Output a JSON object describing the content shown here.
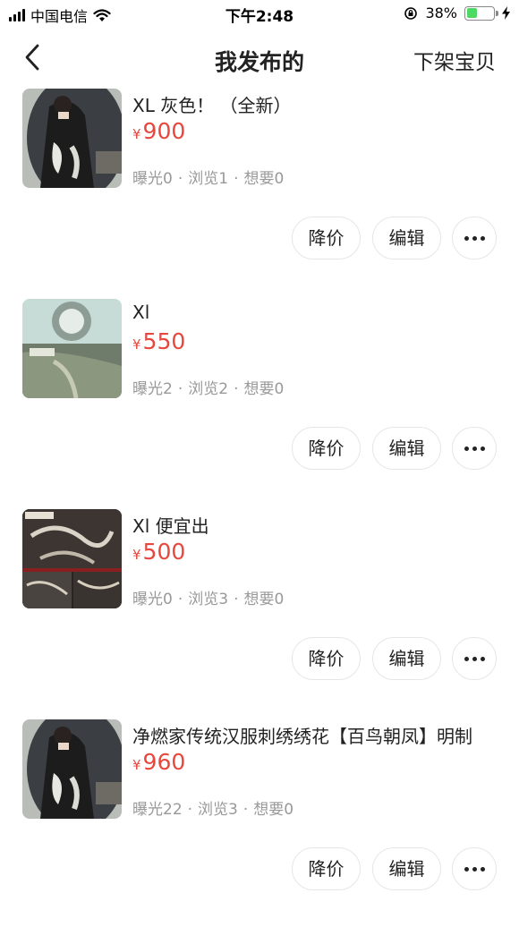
{
  "status_bar": {
    "carrier": "中国电信",
    "time": "下午2:48",
    "battery_percent": "38%",
    "battery_level": 0.38
  },
  "nav": {
    "back_icon": "chevron-left-icon",
    "title": "我发布的",
    "right_action": "下架宝贝"
  },
  "listings": [
    {
      "title": "XL 灰色！ （全新）",
      "currency": "¥",
      "price": "900",
      "stats": {
        "exposure": "曝光0",
        "views": "浏览1",
        "wants": "想要0"
      },
      "actions": {
        "reduce_price": "降价",
        "edit": "编辑"
      }
    },
    {
      "title": "Xl",
      "currency": "¥",
      "price": "550",
      "stats": {
        "exposure": "曝光2",
        "views": "浏览2",
        "wants": "想要0"
      },
      "actions": {
        "reduce_price": "降价",
        "edit": "编辑"
      }
    },
    {
      "title": "Xl 便宜出",
      "currency": "¥",
      "price": "500",
      "stats": {
        "exposure": "曝光0",
        "views": "浏览3",
        "wants": "想要0"
      },
      "actions": {
        "reduce_price": "降价",
        "edit": "编辑"
      }
    },
    {
      "title": "净燃家传统汉服刺绣绣花【百鸟朝凤】明制",
      "currency": "¥",
      "price": "960",
      "stats": {
        "exposure": "曝光22",
        "views": "浏览3",
        "wants": "想要0"
      },
      "actions": {
        "reduce_price": "降价",
        "edit": "编辑"
      }
    }
  ],
  "colors": {
    "price": "#e8473e",
    "muted_text": "#999999",
    "battery_fill": "#4cd964"
  }
}
